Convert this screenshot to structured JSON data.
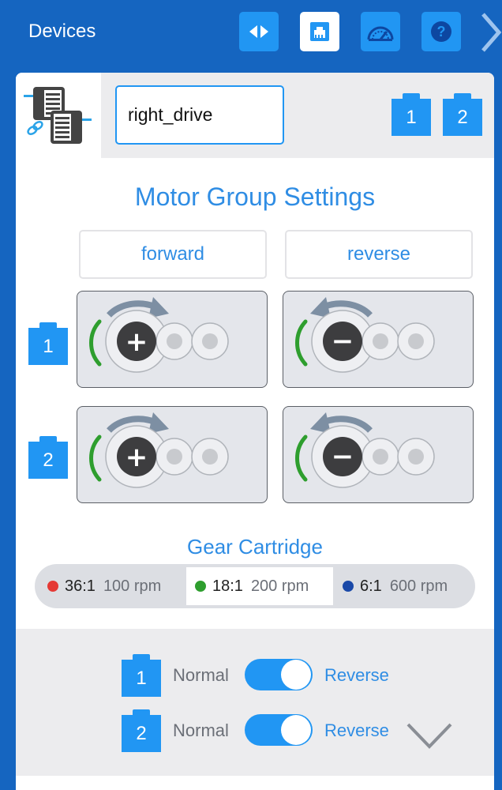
{
  "topbar": {
    "title": "Devices",
    "buttons": [
      {
        "icon": "code-brackets-icon",
        "active": false
      },
      {
        "icon": "ethernet-port-icon",
        "active": true
      },
      {
        "icon": "dashboard-gauge-icon",
        "active": false
      },
      {
        "icon": "help-icon",
        "active": false
      }
    ],
    "overflow_icon": "chevron-right-icon"
  },
  "device": {
    "icon": "motor-group-icon",
    "name": "right_drive",
    "ports": [
      "1",
      "2"
    ]
  },
  "settings": {
    "title": "Motor Group Settings",
    "forward_label": "forward",
    "reverse_label": "reverse",
    "motors": [
      {
        "port": "1",
        "forward_symbol": "+",
        "reverse_symbol": "−"
      },
      {
        "port": "2",
        "forward_symbol": "+",
        "reverse_symbol": "−"
      }
    ]
  },
  "gear": {
    "title": "Gear Cartridge",
    "options": [
      {
        "ratio": "36:1",
        "rpm": "100 rpm",
        "color": "#e53935",
        "selected": false
      },
      {
        "ratio": "18:1",
        "rpm": "200 rpm",
        "color": "#2e9e2e",
        "selected": true
      },
      {
        "ratio": "6:1",
        "rpm": "600 rpm",
        "color": "#1a49a8",
        "selected": false
      }
    ]
  },
  "reverse_settings": [
    {
      "port": "1",
      "left_label": "Normal",
      "right_label": "Reverse",
      "reversed": true
    },
    {
      "port": "2",
      "left_label": "Normal",
      "right_label": "Reverse",
      "reversed": true
    }
  ],
  "colors": {
    "brand_blue": "#1565c0",
    "accent_blue": "#2196f3",
    "text_blue": "#2f8de4",
    "green_indicator": "#2e9e2e"
  }
}
